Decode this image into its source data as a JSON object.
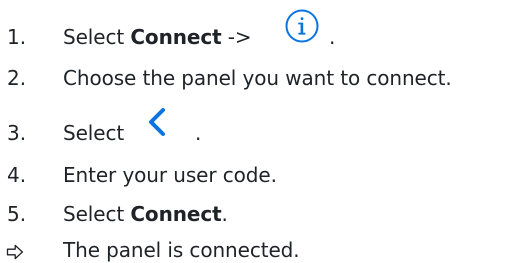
{
  "steps": [
    {
      "number": "1.",
      "prefix": "Select ",
      "bold": "Connect",
      "suffix": " ->",
      "trail": ".",
      "icon": "info-circle-icon"
    },
    {
      "number": "2.",
      "text": "Choose the panel you want to connect."
    },
    {
      "number": "3.",
      "prefix": "Select",
      "trail": ".",
      "icon": "chevron-left-icon"
    },
    {
      "number": "4.",
      "text": "Enter your user code."
    },
    {
      "number": "5.",
      "prefix": "Select ",
      "bold": "Connect",
      "trail": "."
    }
  ],
  "result": {
    "icon": "result-arrow-icon",
    "text": "The panel is connected."
  },
  "colors": {
    "text": "#1f2328",
    "accent": "#0a74e0"
  }
}
